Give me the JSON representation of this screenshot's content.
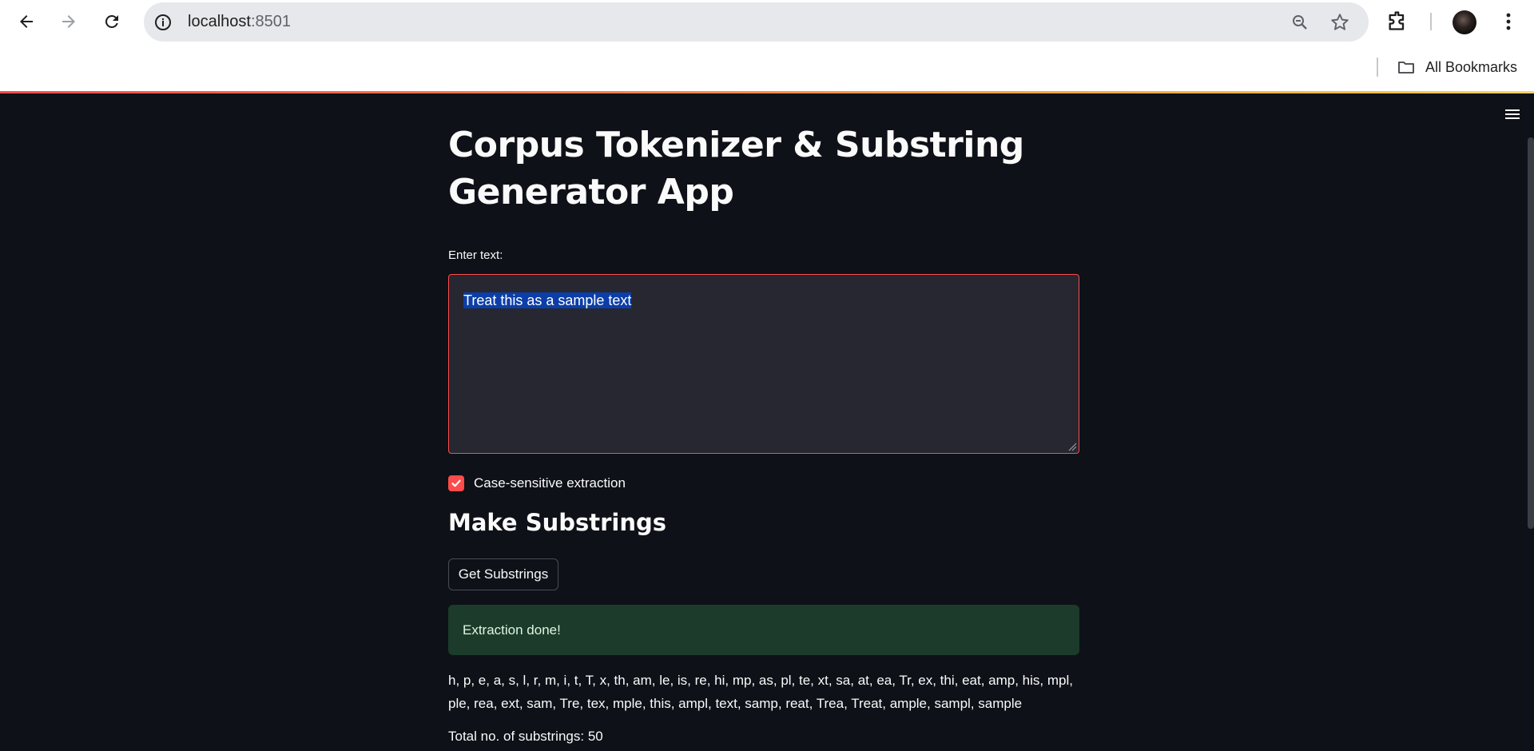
{
  "browser": {
    "url_host": "localhost",
    "url_port": ":8501",
    "bookmarks_label": "All Bookmarks",
    "icons": [
      "back-arrow-icon",
      "forward-arrow-icon",
      "reload-icon",
      "info-icon",
      "zoom-icon",
      "star-icon",
      "extensions-icon",
      "avatar",
      "more-vert-icon",
      "folder-icon"
    ]
  },
  "app": {
    "title": "Corpus Tokenizer & Substring Generator App",
    "input_label": "Enter text:",
    "input_value": "Treat this as a sample text",
    "checkbox_label": "Case-sensitive extraction",
    "checkbox_checked": true,
    "section_heading": "Make Substrings",
    "button_label": "Get Substrings",
    "alert_text": "Extraction done!",
    "substrings_output": "h, p, e, a, s, l, r, m, i, t, T, x, th, am, le, is, re, hi, mp, as, pl, te, xt, sa, at, ea, Tr, ex, thi, eat, amp, his, mpl, ple, rea, ext, sam, Tre, tex, mple, this, ampl, text, samp, reat, Trea, Treat, ample, sampl, sample",
    "total_text": "Total no. of substrings: 50"
  },
  "colors": {
    "app_background": "#0e1117",
    "primary": "#ff4b4b",
    "input_background": "#262730",
    "success_background": "#1c3b2b",
    "selection": "#0b3ea8"
  }
}
